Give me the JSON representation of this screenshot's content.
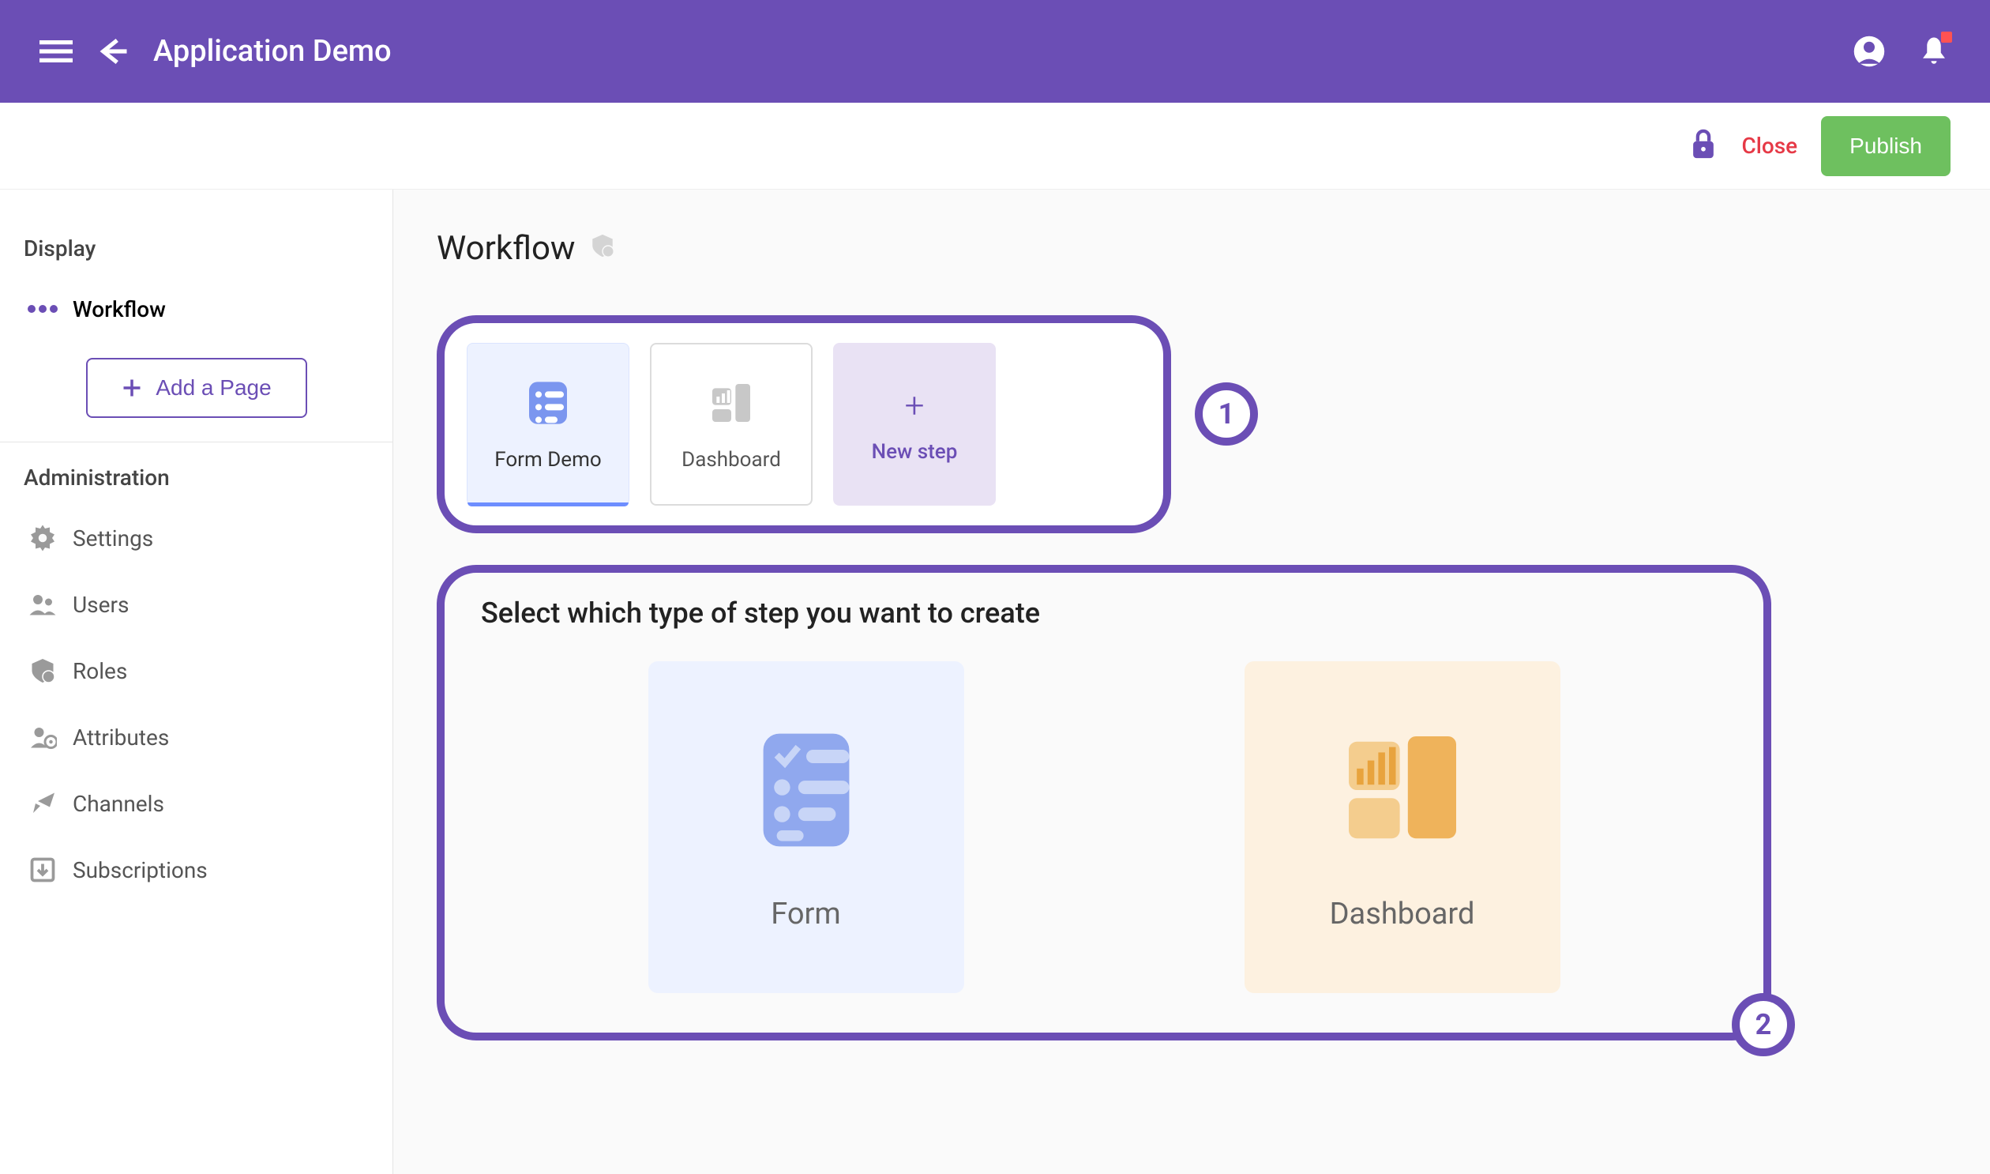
{
  "header": {
    "title": "Application Demo"
  },
  "subheader": {
    "close": "Close",
    "publish": "Publish"
  },
  "sidebar": {
    "section_display": "Display",
    "workflow": "Workflow",
    "add_page": "Add a Page",
    "section_admin": "Administration",
    "items": [
      {
        "label": "Settings"
      },
      {
        "label": "Users"
      },
      {
        "label": "Roles"
      },
      {
        "label": "Attributes"
      },
      {
        "label": "Channels"
      },
      {
        "label": "Subscriptions"
      }
    ]
  },
  "main": {
    "title": "Workflow",
    "steps": [
      {
        "label": "Form Demo"
      },
      {
        "label": "Dashboard"
      },
      {
        "label": "New step"
      }
    ],
    "callout1": "1",
    "callout2": "2",
    "type_select_title": "Select which type of step you want to create",
    "type_form": "Form",
    "type_dashboard": "Dashboard"
  }
}
